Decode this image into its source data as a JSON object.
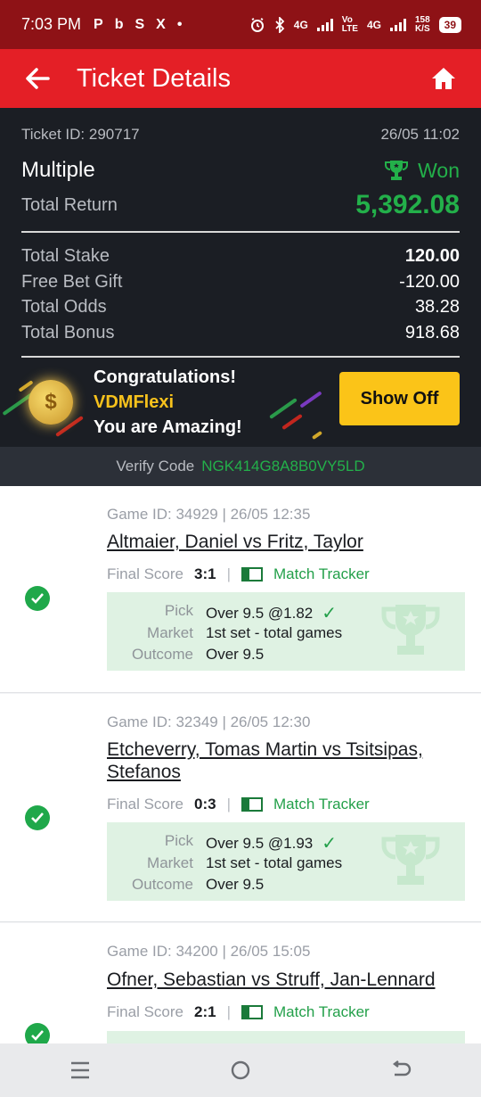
{
  "status_bar": {
    "time": "7:03 PM",
    "left_icons": [
      "P",
      "b",
      "S",
      "X",
      "•"
    ],
    "net1": "4G",
    "vo": "Vo",
    "lte": "LTE",
    "net2": "4G",
    "speed_value": "158",
    "speed_unit": "K/S",
    "battery": "39"
  },
  "app_bar": {
    "title": "Ticket Details",
    "back_icon": "arrow-left-icon",
    "home_icon": "home-icon"
  },
  "ticket": {
    "id_label": "Ticket ID: 290717",
    "datetime": "26/05 11:02",
    "type": "Multiple",
    "status": "Won",
    "total_return_label": "Total Return",
    "total_return": "5,392.08",
    "rows": [
      {
        "label": "Total Stake",
        "value": "120.00"
      },
      {
        "label": "Free Bet Gift",
        "value": "-120.00"
      },
      {
        "label": "Total Odds",
        "value": "38.28"
      },
      {
        "label": "Total Bonus",
        "value": "918.68"
      }
    ]
  },
  "promo": {
    "line1": "Congratulations!",
    "username": "VDMFlexi",
    "line3": "You are Amazing!",
    "button": "Show Off"
  },
  "verify": {
    "label": "Verify Code",
    "code": "NGK414G8A8B0VY5LD"
  },
  "games": [
    {
      "game_id": "Game ID: 34929 | 26/05 12:35",
      "teams": "Altmaier, Daniel vs Fritz, Taylor",
      "final_score_label": "Final Score",
      "score": "3:1",
      "tracker": "Match Tracker",
      "pick_label": "Pick",
      "pick": "Over 9.5 @1.82",
      "market_label": "Market",
      "market": "1st set - total games",
      "outcome_label": "Outcome",
      "outcome": "Over 9.5"
    },
    {
      "game_id": "Game ID: 32349 | 26/05 12:30",
      "teams": "Etcheverry, Tomas Martin vs Tsitsipas, Stefanos",
      "final_score_label": "Final Score",
      "score": "0:3",
      "tracker": "Match Tracker",
      "pick_label": "Pick",
      "pick": "Over 9.5 @1.93",
      "market_label": "Market",
      "market": "1st set - total games",
      "outcome_label": "Outcome",
      "outcome": "Over 9.5"
    },
    {
      "game_id": "Game ID: 34200 | 26/05 15:05",
      "teams": "Ofner, Sebastian vs Struff, Jan-Lennard",
      "final_score_label": "Final Score",
      "score": "2:1",
      "tracker": "Match Tracker"
    }
  ],
  "colors": {
    "brand_red": "#e41f26",
    "win_green": "#23b04a",
    "promo_yellow": "#fbc418"
  }
}
